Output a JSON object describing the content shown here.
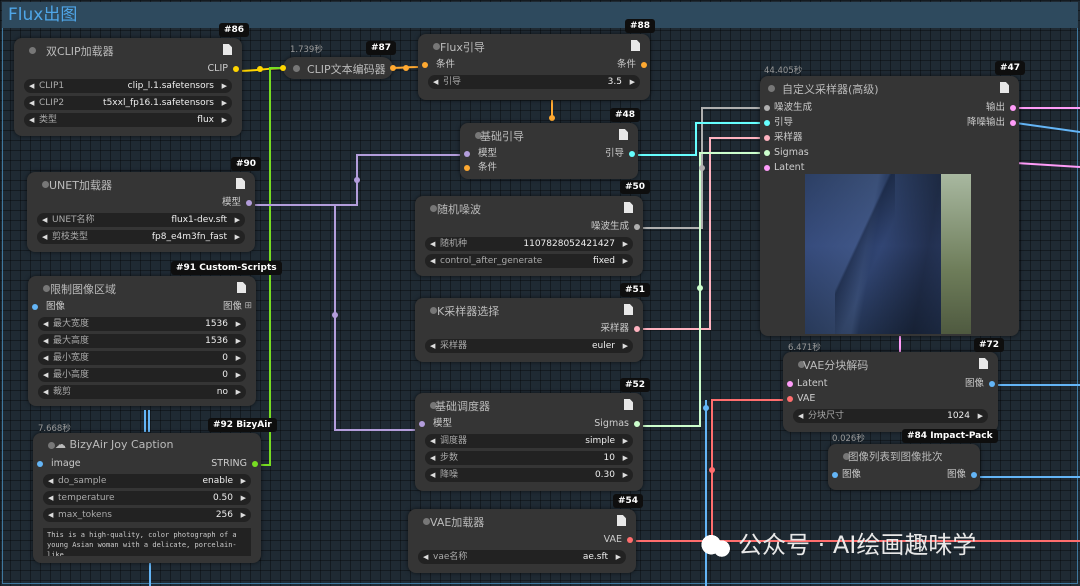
{
  "group": {
    "title": "Flux出图"
  },
  "colors": {
    "clip": "#ffd500",
    "conditioning": "#ffa931",
    "model": "#b39ddb",
    "noise": "#b0b0b0",
    "sampler": "#ffb3c0",
    "sigmas": "#cdffcd",
    "guider": "#66ffff",
    "latent": "#ff9cf9",
    "vae": "#ff6e6e",
    "image": "#64b5f6",
    "string": "#77dd22"
  },
  "nodes": {
    "n86": {
      "badge": "#86",
      "title": "双CLIP加载器",
      "output": "CLIP",
      "widgets": [
        {
          "label": "CLIP1",
          "value": "clip_l.1.safetensors"
        },
        {
          "label": "CLIP2",
          "value": "t5xxl_fp16.1.safetensors"
        },
        {
          "label": "类型",
          "value": "flux"
        }
      ]
    },
    "n87": {
      "badge": "#87",
      "timing": "1.739秒",
      "title": "CLIP文本编码器"
    },
    "n88": {
      "badge": "#88",
      "title": "Flux引导",
      "input": "条件",
      "output": "条件",
      "widgets": [
        {
          "label": "引导",
          "value": "3.5"
        }
      ]
    },
    "n90": {
      "badge": "#90",
      "title": "UNET加载器",
      "output": "模型",
      "widgets": [
        {
          "label": "UNET名称",
          "value": "flux1-dev.sft"
        },
        {
          "label": "剪枝类型",
          "value": "fp8_e4m3fn_fast"
        }
      ]
    },
    "n91": {
      "badge": "#91 Custom-Scripts",
      "title": "限制图像区域",
      "input": "图像",
      "output": "图像",
      "widgets": [
        {
          "label": "最大宽度",
          "value": "1536"
        },
        {
          "label": "最大高度",
          "value": "1536"
        },
        {
          "label": "最小宽度",
          "value": "0"
        },
        {
          "label": "最小高度",
          "value": "0"
        },
        {
          "label": "裁剪",
          "value": "no"
        }
      ]
    },
    "n92": {
      "badge": "#92 BizyAir",
      "timing": "7.668秒",
      "title": "BizyAir Joy Caption",
      "input": "image",
      "output": "STRING",
      "widgets": [
        {
          "label": "do_sample",
          "value": "enable"
        },
        {
          "label": "temperature",
          "value": "0.50"
        },
        {
          "label": "max_tokens",
          "value": "256"
        }
      ],
      "text": "This is a high-quality, color photograph of a young Asian woman with a delicate, porcelain-like"
    },
    "n48": {
      "badge": "#48",
      "title": "基础引导",
      "inputs": [
        "模型",
        "条件"
      ],
      "output": "引导"
    },
    "n50": {
      "badge": "#50",
      "title": "随机噪波",
      "output": "噪波生成",
      "widgets": [
        {
          "label": "随机种",
          "value": "1107828052421427"
        },
        {
          "label": "control_after_generate",
          "value": "fixed"
        }
      ]
    },
    "n51": {
      "badge": "#51",
      "title": "K采样器选择",
      "output": "采样器",
      "widgets": [
        {
          "label": "采样器",
          "value": "euler"
        }
      ]
    },
    "n52": {
      "badge": "#52",
      "title": "基础调度器",
      "input": "模型",
      "output": "Sigmas",
      "widgets": [
        {
          "label": "调度器",
          "value": "simple"
        },
        {
          "label": "步数",
          "value": "10"
        },
        {
          "label": "降噪",
          "value": "0.30"
        }
      ]
    },
    "n54": {
      "badge": "#54",
      "title": "VAE加载器",
      "output": "VAE",
      "widgets": [
        {
          "label": "vae名称",
          "value": "ae.sft"
        }
      ]
    },
    "n47": {
      "badge": "#47",
      "timing": "44.405秒",
      "title": "自定义采样器(高级)",
      "inputs": [
        "噪波生成",
        "引导",
        "采样器",
        "Sigmas",
        "Latent"
      ],
      "outputs": [
        "输出",
        "降噪输出"
      ]
    },
    "n72": {
      "badge": "#72",
      "timing": "6.471秒",
      "title": "VAE分块解码",
      "inputs": [
        "Latent",
        "VAE"
      ],
      "output": "图像",
      "widgets": [
        {
          "label": "分块尺寸",
          "value": "1024"
        }
      ]
    },
    "n84": {
      "badge": "#84 Impact-Pack",
      "timing": "0.026秒",
      "title": "图像列表到图像批次",
      "input": "图像",
      "output": "图像"
    }
  },
  "watermark": {
    "text": "公众号 · AI绘画趣味学"
  }
}
